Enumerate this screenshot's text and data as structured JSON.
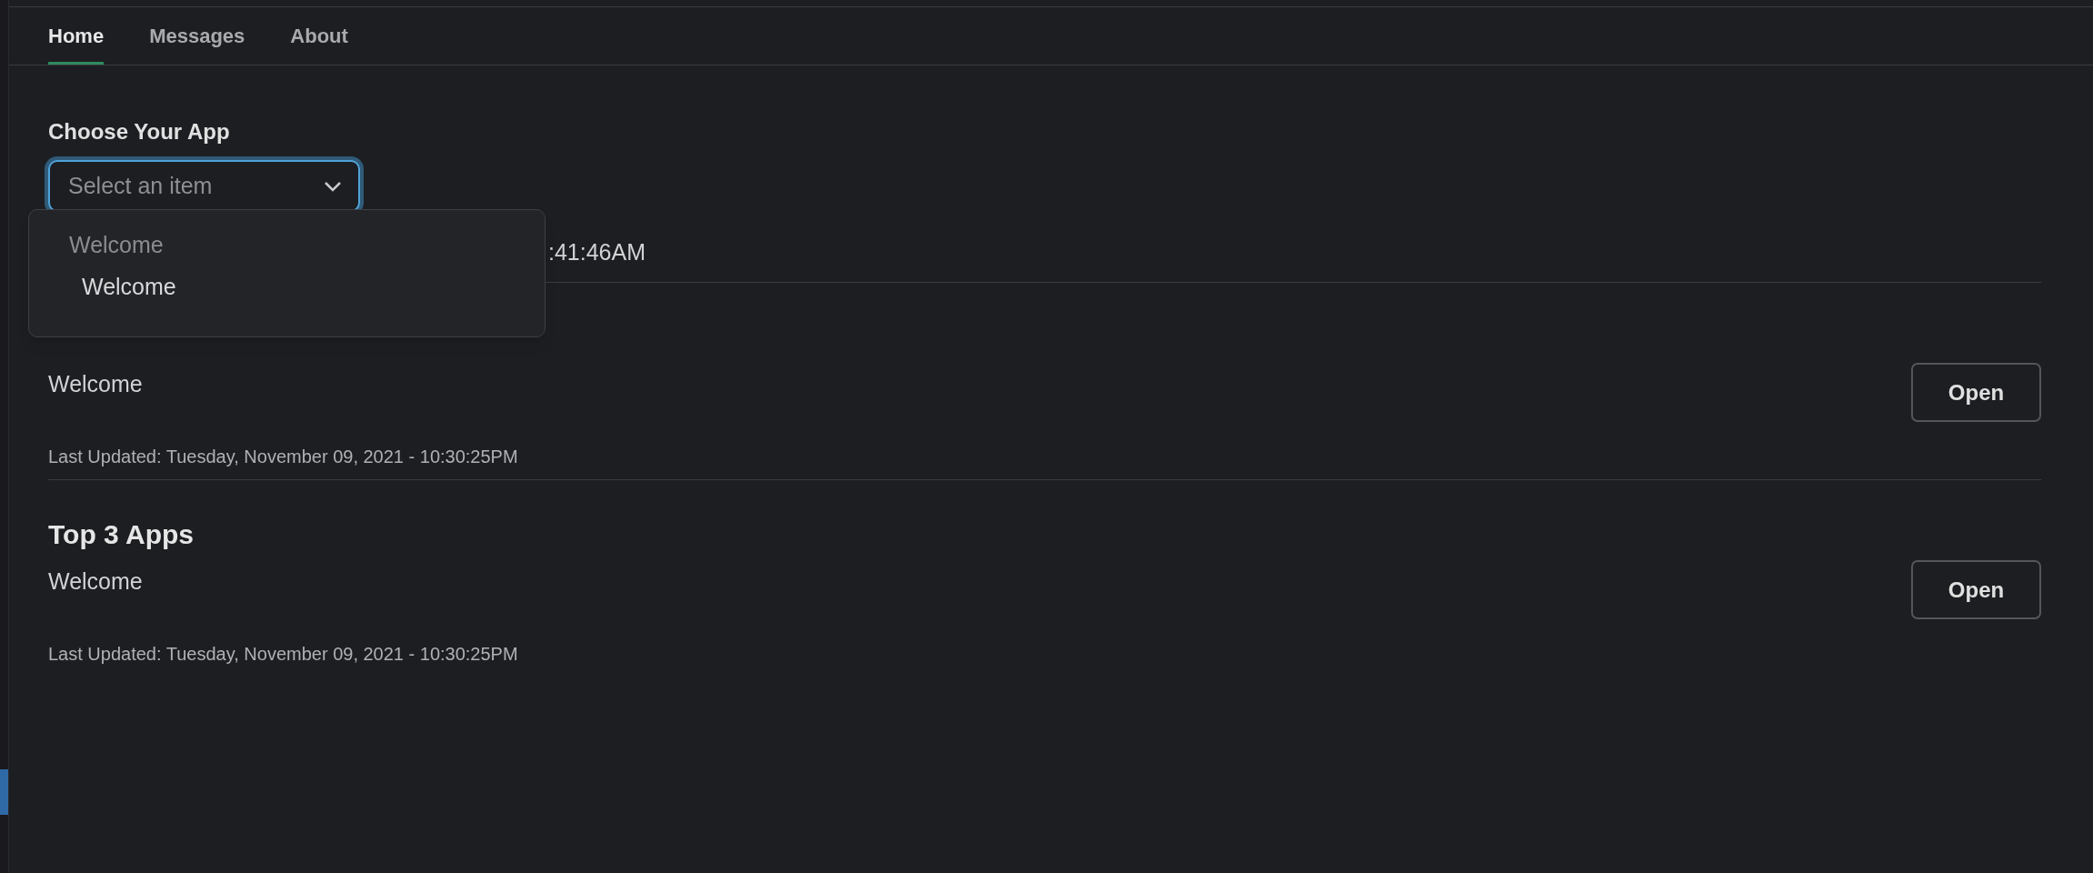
{
  "tabs": [
    {
      "label": "Home",
      "selected": true
    },
    {
      "label": "Messages",
      "selected": false
    },
    {
      "label": "About",
      "selected": false
    }
  ],
  "app_picker": {
    "label": "Choose Your App",
    "placeholder": "Select an item",
    "focused": true,
    "expanded": true,
    "options": [
      {
        "kind": "group",
        "label": "Welcome"
      },
      {
        "kind": "option",
        "label": "Welcome"
      }
    ]
  },
  "status_line": ":41:46AM",
  "sections": [
    {
      "text": "Welcome",
      "updated": "Last Updated: Tuesday, November 09, 2021 - 10:30:25PM",
      "button": "Open"
    },
    {
      "title": "Top 3 Apps",
      "text": "Welcome",
      "updated": "Last Updated: Tuesday, November 09, 2021 - 10:30:25PM",
      "button": "Open"
    }
  ]
}
